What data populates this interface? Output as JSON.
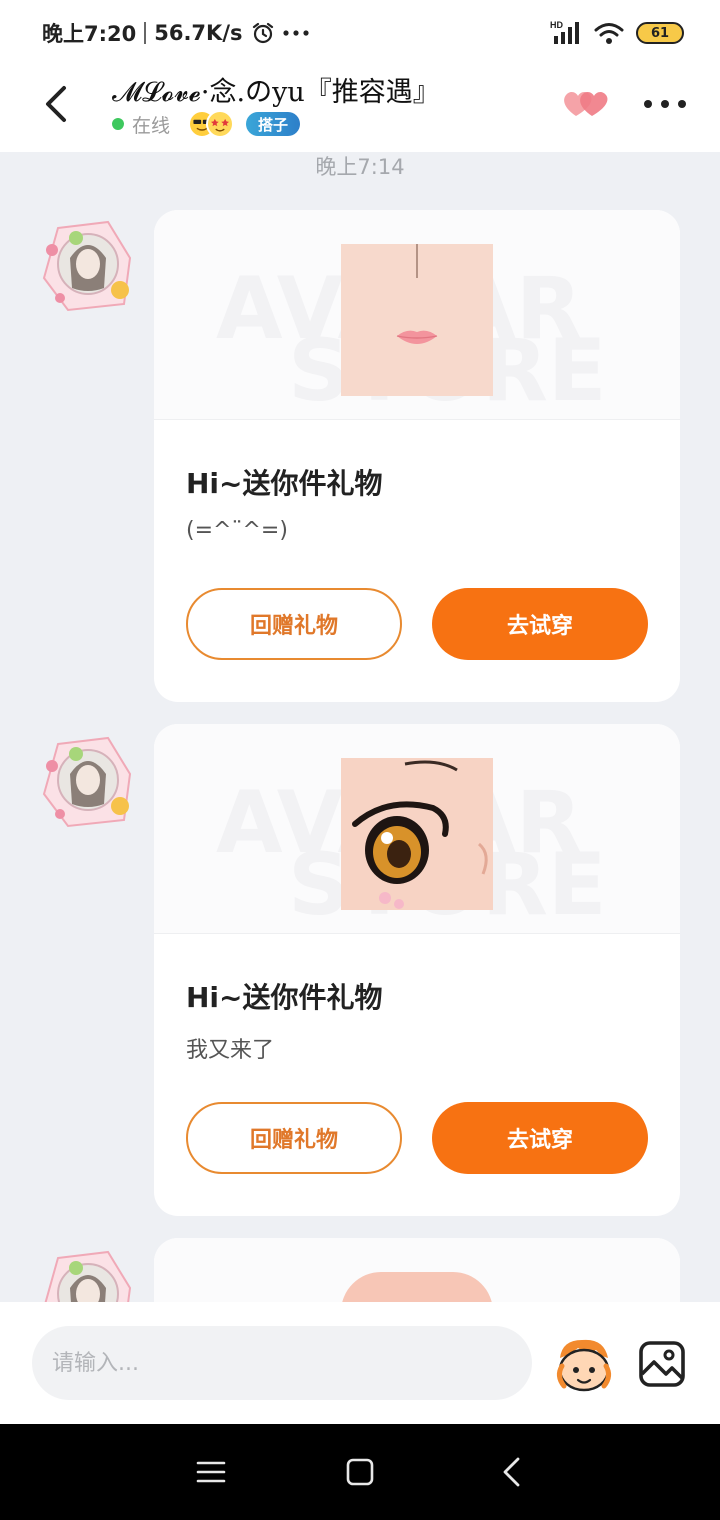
{
  "status_bar": {
    "time": "晚上7:20",
    "speed": "56.7K/s",
    "network_label": "HD",
    "battery": "61"
  },
  "header": {
    "contact_name": "𝓜𝓛𝓸𝓿𝓮·念.のyu『推容遇』",
    "status": "在线",
    "badge": "搭子"
  },
  "chat": {
    "timestamp": "晚上7:14",
    "messages": [
      {
        "title": "Hi~送你件礼物",
        "text": "(=^¨^=)",
        "return_label": "回赠礼物",
        "try_label": "去试穿",
        "item": "lips"
      },
      {
        "title": "Hi~送你件礼物",
        "text": "我又来了",
        "return_label": "回赠礼物",
        "try_label": "去试穿",
        "item": "eye"
      },
      {
        "title": "",
        "text": "",
        "return_label": "",
        "try_label": "",
        "item": "partial"
      }
    ]
  },
  "input": {
    "placeholder": "请输入..."
  },
  "colors": {
    "accent": "#f77212",
    "online": "#3ec85e",
    "background": "#eef0f4"
  }
}
